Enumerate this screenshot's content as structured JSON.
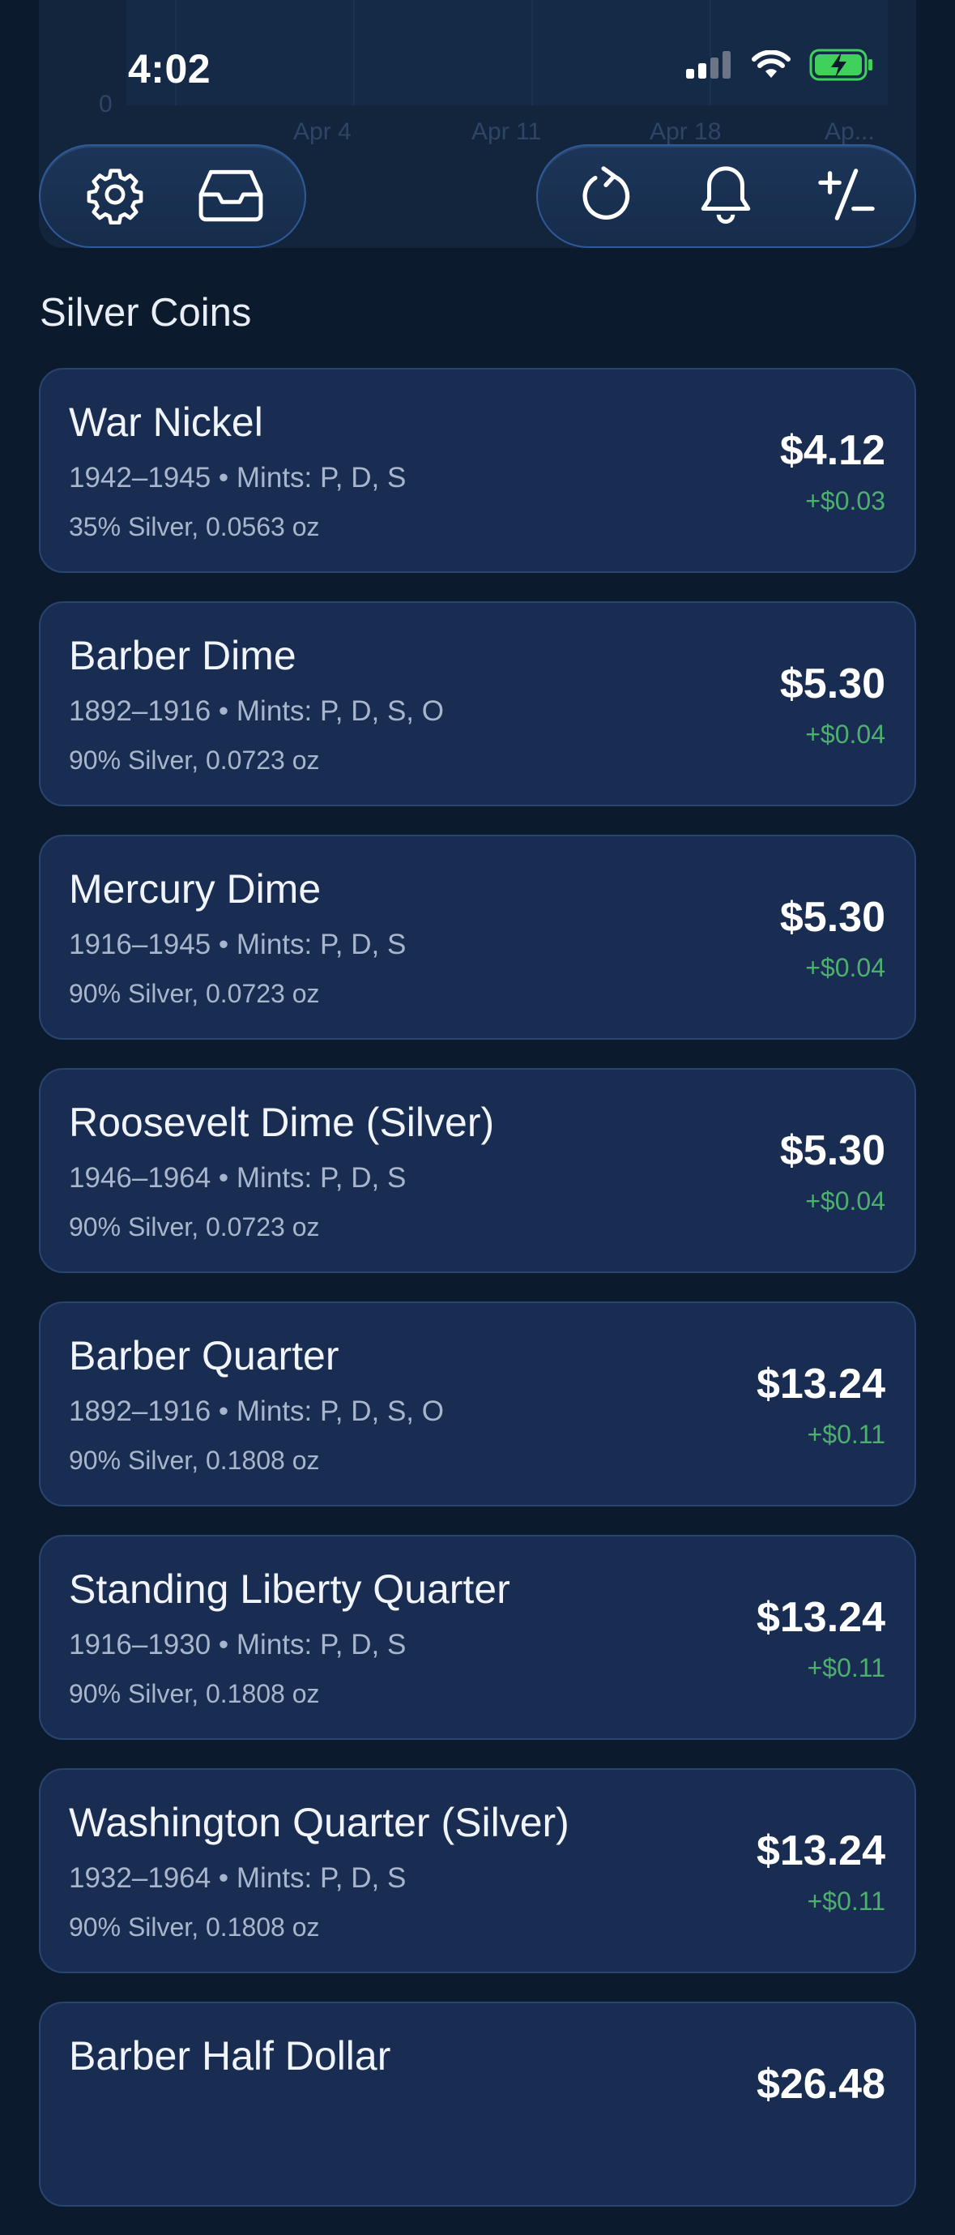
{
  "status_bar": {
    "time": "4:02"
  },
  "chart_remnant": {
    "y_tick": "0",
    "x_ticks": [
      "Apr 4",
      "Apr 11",
      "Apr 18",
      "Ap..."
    ]
  },
  "toolbar": {
    "left_icons": [
      "gear-icon",
      "inbox-icon"
    ],
    "right_icons": [
      "refresh-icon",
      "bell-icon",
      "plus-minus-icon"
    ]
  },
  "section": {
    "title": "Silver Coins"
  },
  "colors": {
    "background": "#0b1a2d",
    "card": "#192d52",
    "positive": "#4caf6f",
    "battery": "#3fd15c"
  },
  "coins": [
    {
      "name": "War Nickel",
      "meta": "1942–1945 • Mints: P, D, S",
      "composition": "35% Silver, 0.0563 oz",
      "price": "$4.12",
      "change": "+$0.03"
    },
    {
      "name": "Barber Dime",
      "meta": "1892–1916 • Mints: P, D, S, O",
      "composition": "90% Silver, 0.0723 oz",
      "price": "$5.30",
      "change": "+$0.04"
    },
    {
      "name": "Mercury Dime",
      "meta": "1916–1945 • Mints: P, D, S",
      "composition": "90% Silver, 0.0723 oz",
      "price": "$5.30",
      "change": "+$0.04"
    },
    {
      "name": "Roosevelt Dime (Silver)",
      "meta": "1946–1964 • Mints: P, D, S",
      "composition": "90% Silver, 0.0723 oz",
      "price": "$5.30",
      "change": "+$0.04"
    },
    {
      "name": "Barber Quarter",
      "meta": "1892–1916 • Mints: P, D, S, O",
      "composition": "90% Silver, 0.1808 oz",
      "price": "$13.24",
      "change": "+$0.11"
    },
    {
      "name": "Standing Liberty Quarter",
      "meta": "1916–1930 • Mints: P, D, S",
      "composition": "90% Silver, 0.1808 oz",
      "price": "$13.24",
      "change": "+$0.11"
    },
    {
      "name": "Washington Quarter (Silver)",
      "meta": "1932–1964 • Mints: P, D, S",
      "composition": "90% Silver, 0.1808 oz",
      "price": "$13.24",
      "change": "+$0.11"
    },
    {
      "name": "Barber Half Dollar",
      "meta": "",
      "composition": "",
      "price": "$26.48",
      "change": ""
    }
  ]
}
